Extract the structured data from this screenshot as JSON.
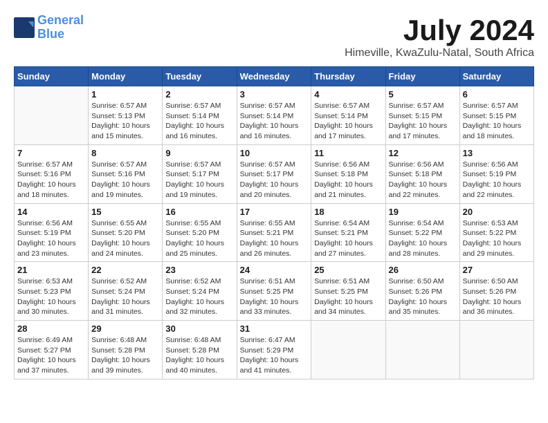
{
  "header": {
    "logo_line1": "General",
    "logo_line2": "Blue",
    "month_year": "July 2024",
    "location": "Himeville, KwaZulu-Natal, South Africa"
  },
  "weekdays": [
    "Sunday",
    "Monday",
    "Tuesday",
    "Wednesday",
    "Thursday",
    "Friday",
    "Saturday"
  ],
  "weeks": [
    [
      {
        "day": "",
        "info": ""
      },
      {
        "day": "1",
        "info": "Sunrise: 6:57 AM\nSunset: 5:13 PM\nDaylight: 10 hours\nand 15 minutes."
      },
      {
        "day": "2",
        "info": "Sunrise: 6:57 AM\nSunset: 5:14 PM\nDaylight: 10 hours\nand 16 minutes."
      },
      {
        "day": "3",
        "info": "Sunrise: 6:57 AM\nSunset: 5:14 PM\nDaylight: 10 hours\nand 16 minutes."
      },
      {
        "day": "4",
        "info": "Sunrise: 6:57 AM\nSunset: 5:14 PM\nDaylight: 10 hours\nand 17 minutes."
      },
      {
        "day": "5",
        "info": "Sunrise: 6:57 AM\nSunset: 5:15 PM\nDaylight: 10 hours\nand 17 minutes."
      },
      {
        "day": "6",
        "info": "Sunrise: 6:57 AM\nSunset: 5:15 PM\nDaylight: 10 hours\nand 18 minutes."
      }
    ],
    [
      {
        "day": "7",
        "info": "Sunrise: 6:57 AM\nSunset: 5:16 PM\nDaylight: 10 hours\nand 18 minutes."
      },
      {
        "day": "8",
        "info": "Sunrise: 6:57 AM\nSunset: 5:16 PM\nDaylight: 10 hours\nand 19 minutes."
      },
      {
        "day": "9",
        "info": "Sunrise: 6:57 AM\nSunset: 5:17 PM\nDaylight: 10 hours\nand 19 minutes."
      },
      {
        "day": "10",
        "info": "Sunrise: 6:57 AM\nSunset: 5:17 PM\nDaylight: 10 hours\nand 20 minutes."
      },
      {
        "day": "11",
        "info": "Sunrise: 6:56 AM\nSunset: 5:18 PM\nDaylight: 10 hours\nand 21 minutes."
      },
      {
        "day": "12",
        "info": "Sunrise: 6:56 AM\nSunset: 5:18 PM\nDaylight: 10 hours\nand 22 minutes."
      },
      {
        "day": "13",
        "info": "Sunrise: 6:56 AM\nSunset: 5:19 PM\nDaylight: 10 hours\nand 22 minutes."
      }
    ],
    [
      {
        "day": "14",
        "info": "Sunrise: 6:56 AM\nSunset: 5:19 PM\nDaylight: 10 hours\nand 23 minutes."
      },
      {
        "day": "15",
        "info": "Sunrise: 6:55 AM\nSunset: 5:20 PM\nDaylight: 10 hours\nand 24 minutes."
      },
      {
        "day": "16",
        "info": "Sunrise: 6:55 AM\nSunset: 5:20 PM\nDaylight: 10 hours\nand 25 minutes."
      },
      {
        "day": "17",
        "info": "Sunrise: 6:55 AM\nSunset: 5:21 PM\nDaylight: 10 hours\nand 26 minutes."
      },
      {
        "day": "18",
        "info": "Sunrise: 6:54 AM\nSunset: 5:21 PM\nDaylight: 10 hours\nand 27 minutes."
      },
      {
        "day": "19",
        "info": "Sunrise: 6:54 AM\nSunset: 5:22 PM\nDaylight: 10 hours\nand 28 minutes."
      },
      {
        "day": "20",
        "info": "Sunrise: 6:53 AM\nSunset: 5:22 PM\nDaylight: 10 hours\nand 29 minutes."
      }
    ],
    [
      {
        "day": "21",
        "info": "Sunrise: 6:53 AM\nSunset: 5:23 PM\nDaylight: 10 hours\nand 30 minutes."
      },
      {
        "day": "22",
        "info": "Sunrise: 6:52 AM\nSunset: 5:24 PM\nDaylight: 10 hours\nand 31 minutes."
      },
      {
        "day": "23",
        "info": "Sunrise: 6:52 AM\nSunset: 5:24 PM\nDaylight: 10 hours\nand 32 minutes."
      },
      {
        "day": "24",
        "info": "Sunrise: 6:51 AM\nSunset: 5:25 PM\nDaylight: 10 hours\nand 33 minutes."
      },
      {
        "day": "25",
        "info": "Sunrise: 6:51 AM\nSunset: 5:25 PM\nDaylight: 10 hours\nand 34 minutes."
      },
      {
        "day": "26",
        "info": "Sunrise: 6:50 AM\nSunset: 5:26 PM\nDaylight: 10 hours\nand 35 minutes."
      },
      {
        "day": "27",
        "info": "Sunrise: 6:50 AM\nSunset: 5:26 PM\nDaylight: 10 hours\nand 36 minutes."
      }
    ],
    [
      {
        "day": "28",
        "info": "Sunrise: 6:49 AM\nSunset: 5:27 PM\nDaylight: 10 hours\nand 37 minutes."
      },
      {
        "day": "29",
        "info": "Sunrise: 6:48 AM\nSunset: 5:28 PM\nDaylight: 10 hours\nand 39 minutes."
      },
      {
        "day": "30",
        "info": "Sunrise: 6:48 AM\nSunset: 5:28 PM\nDaylight: 10 hours\nand 40 minutes."
      },
      {
        "day": "31",
        "info": "Sunrise: 6:47 AM\nSunset: 5:29 PM\nDaylight: 10 hours\nand 41 minutes."
      },
      {
        "day": "",
        "info": ""
      },
      {
        "day": "",
        "info": ""
      },
      {
        "day": "",
        "info": ""
      }
    ]
  ]
}
